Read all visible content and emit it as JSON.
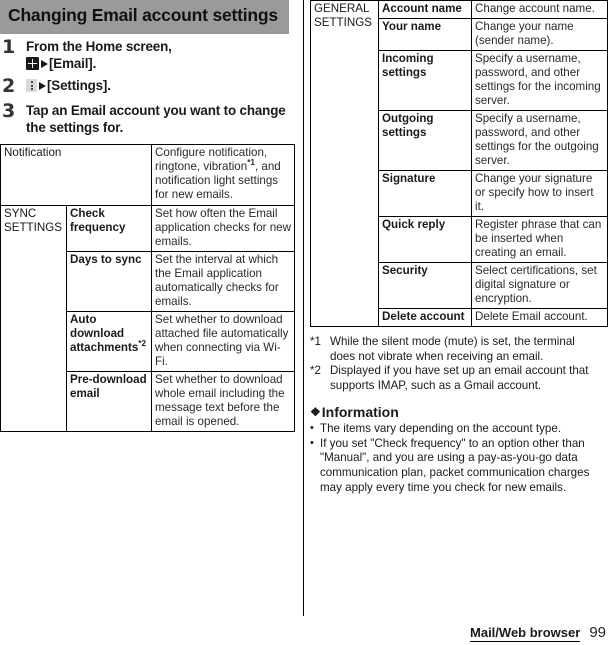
{
  "section": {
    "title": "Changing Email account settings"
  },
  "steps": [
    {
      "num": "1",
      "pre": "From the Home screen,",
      "icon": "app-drawer-grid-icon",
      "arrow": "▶",
      "post": "[Email]."
    },
    {
      "num": "2",
      "pre": "",
      "icon": "overflow-menu-icon",
      "arrow": "▶",
      "post": "[Settings]."
    },
    {
      "num": "3",
      "text": "Tap an Email account you want to change the settings for."
    }
  ],
  "table_left": {
    "rows": [
      {
        "group": "",
        "group_rowspan": 0,
        "item": "Notification",
        "item_colspan": 2,
        "item_bold": false,
        "desc_pre": "Configure notification, ringtone, vibration",
        "desc_sup": "*1",
        "desc_post": ", and notification light settings for new emails."
      },
      {
        "group": "SYNC SETTINGS",
        "group_rowspan": 4,
        "item": "Check frequency",
        "item_bold": true,
        "desc": "Set how often the Email application checks for new emails."
      },
      {
        "item": "Days to sync",
        "item_bold": true,
        "desc": "Set the interval at which the Email application automatically checks for emails."
      },
      {
        "item_pre": "Auto download attachments",
        "item_sup": "*2",
        "item_bold": true,
        "desc": "Set whether to download attached file automatically when connecting via Wi-Fi."
      },
      {
        "item": "Pre-download email",
        "item_bold": true,
        "desc": "Set whether to download whole email including the message text before the email is opened."
      }
    ]
  },
  "table_right": {
    "group": "GENERAL SETTINGS",
    "rows": [
      {
        "item": "Account name",
        "desc": "Change account name."
      },
      {
        "item": "Your name",
        "desc": "Change your name (sender name)."
      },
      {
        "item": "Incoming settings",
        "desc": "Specify a username, password, and other settings for the incoming server."
      },
      {
        "item": "Outgoing settings",
        "desc": "Specify a username, password, and other settings for the outgoing server."
      },
      {
        "item": "Signature",
        "desc": "Change your signature or specify how to insert it."
      },
      {
        "item": "Quick reply",
        "desc": "Register phrase that can be inserted when creating an email."
      },
      {
        "item": "Security",
        "desc": "Select certifications, set digital signature or encryption."
      },
      {
        "item": "Delete account",
        "desc": "Delete Email account."
      }
    ]
  },
  "footnotes": [
    {
      "mark": "*1",
      "text": "While the silent mode (mute) is set, the terminal does not vibrate when receiving an email."
    },
    {
      "mark": "*2",
      "text": "Displayed if you have set up an email account that supports IMAP, such as a Gmail account."
    }
  ],
  "information": {
    "diamond": "❖",
    "heading": "Information",
    "bullet": "•",
    "items": [
      "The items vary depending on the account type.",
      "If you set \"Check frequency\" to an option other than \"Manual\", and you are using a pay-as-you-go data communication plan, packet communication charges may apply every time you check for new emails."
    ]
  },
  "footer": {
    "title": "Mail/Web browser",
    "page": "99"
  },
  "colors": {
    "title_band": "#9a9a9a",
    "rule": "#000000",
    "text": "#1a1a1a"
  }
}
